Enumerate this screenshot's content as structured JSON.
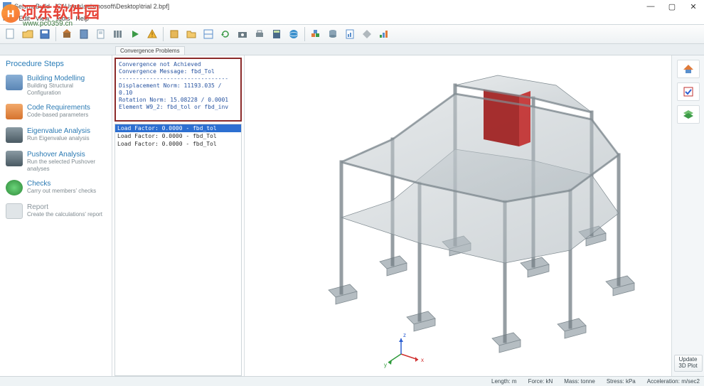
{
  "title": {
    "app": "SeismoBuild",
    "file": "[C:\\Users\\seismosoft\\Desktop\\trial 2.bpf]"
  },
  "win": {
    "min": "—",
    "max": "▢",
    "close": "✕"
  },
  "menu": [
    "File",
    "Edit",
    "View",
    "Tools",
    "Help"
  ],
  "watermark": {
    "badge": "H",
    "text": "河东软件园",
    "url": "www.pc0359.cn"
  },
  "tabs": {
    "main": "Convergence Problems"
  },
  "side": {
    "title": "Procedure Steps",
    "steps": [
      {
        "h": "Building Modelling",
        "s": "Building Structural Configuration",
        "ic": "#6f95c2"
      },
      {
        "h": "Code Requirements",
        "s": "Code-based parameters",
        "ic": "#e07a3a"
      },
      {
        "h": "Eigenvalue Analysis",
        "s": "Run Eigenvalue analysis",
        "ic": "#5a6f7a"
      },
      {
        "h": "Pushover Analysis",
        "s": "Run the selected Pushover analyses",
        "ic": "#5a6f7a"
      },
      {
        "h": "Checks",
        "s": "Carry out members' checks",
        "ic": "#3fae49"
      },
      {
        "h": "Report",
        "s": "Create the calculations' report",
        "ic": "#c9d0d4"
      }
    ]
  },
  "conv": {
    "l1": "Convergence not Achieved",
    "l2": "Convergence Message: fbd_Tol",
    "l3": "--------------------------------",
    "l4": "Displacement Norm: 11193.035 / 0.10",
    "l5": "Rotation Norm: 15.08228 / 0.0001",
    "l6": "",
    "l7": "Element W9_2: fbd_tol or fbd_inv"
  },
  "loads": [
    {
      "t": "Load Factor: 0.0000 - fbd_tol",
      "sel": true
    },
    {
      "t": "Load Factor: 0.0000 - fbd_Tol",
      "sel": false
    },
    {
      "t": "Load Factor: 0.0000 - fbd_Tol",
      "sel": false
    }
  ],
  "right": {
    "update": "Update 3D Plot"
  },
  "status": {
    "len": "Length: m",
    "force": "Force: kN",
    "mass": "Mass: tonne",
    "stress": "Stress: kPa",
    "accel": "Acceleration: m/sec2"
  },
  "axes": {
    "x": "x",
    "y": "y",
    "z": "z"
  }
}
